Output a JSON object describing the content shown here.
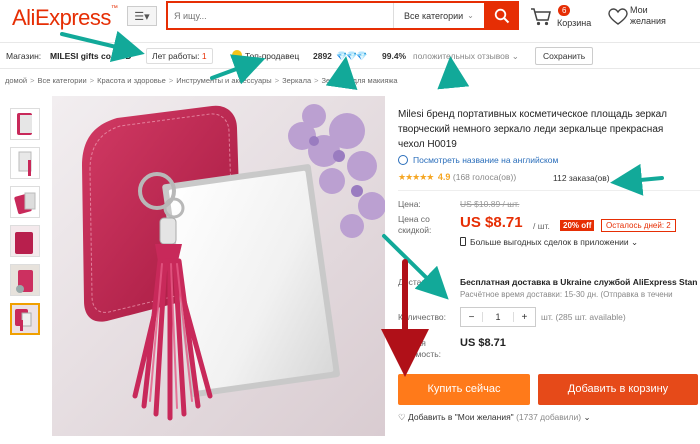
{
  "header": {
    "logo": "AliExpress",
    "logo_tm": "™",
    "search_placeholder": "Я ищу...",
    "category": "Все категории",
    "cart_count": "6",
    "cart_label": "Корзина",
    "wish_line1": "Мои",
    "wish_line2": "желания"
  },
  "store": {
    "label": "Магазин:",
    "name": "MILESI gifts co.,LTD",
    "years_label": "Лет работы:",
    "years_value": "1",
    "top_seller": "Топ-продавец",
    "score": "2892",
    "diamonds": "💎💎💎",
    "positive_pct": "99.4%",
    "positive_label": "положительных отзывов",
    "save_button": "Сохранить"
  },
  "breadcrumb": [
    "домой",
    "Все категории",
    "Красота и здоровье",
    "Инструменты и аксессуары",
    "Зеркала",
    "Зеркала для макияжа"
  ],
  "product": {
    "title_line1": "Milesi бренд портативных косметическое площадь зеркал",
    "title_line2": "творческий немного зеркало леди зеркальце прекрасная",
    "title_line3": "чехол H0019",
    "english_link": "Посмотреть название на английском",
    "stars": "★★★★★",
    "rating": "4.9",
    "votes": "(168 голоса(ов))",
    "orders": "112 заказа(ов)"
  },
  "pricing": {
    "price_label": "Цена:",
    "old_price": "US $10.89 / шт.",
    "discount_label_1": "Цена со",
    "discount_label_2": "скидкой:",
    "new_price": "US $8.71",
    "per_unit": "/ шт.",
    "discount": "20% off",
    "days_left": "Осталось дней: 2",
    "app_deal": "Больше выгодных сделок в приложении"
  },
  "shipping": {
    "label": "Доставка:",
    "line1": "Бесплатная доставка в Ukraine службой AliExpress Stan",
    "line2": "Расчётное время доставки: 15-30 дн. (Отправка в течени"
  },
  "quantity": {
    "label": "Количество:",
    "minus": "−",
    "value": "1",
    "plus": "+",
    "available": "шт. (285 шт. available)"
  },
  "total": {
    "label_1": "Общая",
    "label_2": "стоимость:",
    "value": "US $8.71"
  },
  "actions": {
    "buy_now": "Купить сейчас",
    "add_to_cart": "Добавить в корзину",
    "wishlist": "Добавить в \"Мои желания\"",
    "wishlist_count": "(1737 добавили)"
  },
  "colors": {
    "brand": "#e62e04",
    "buy": "#ff7a1a",
    "cart": "#e64a19",
    "annotation_arrow": "#12a999",
    "annotation_arrow_red": "#b01018"
  }
}
